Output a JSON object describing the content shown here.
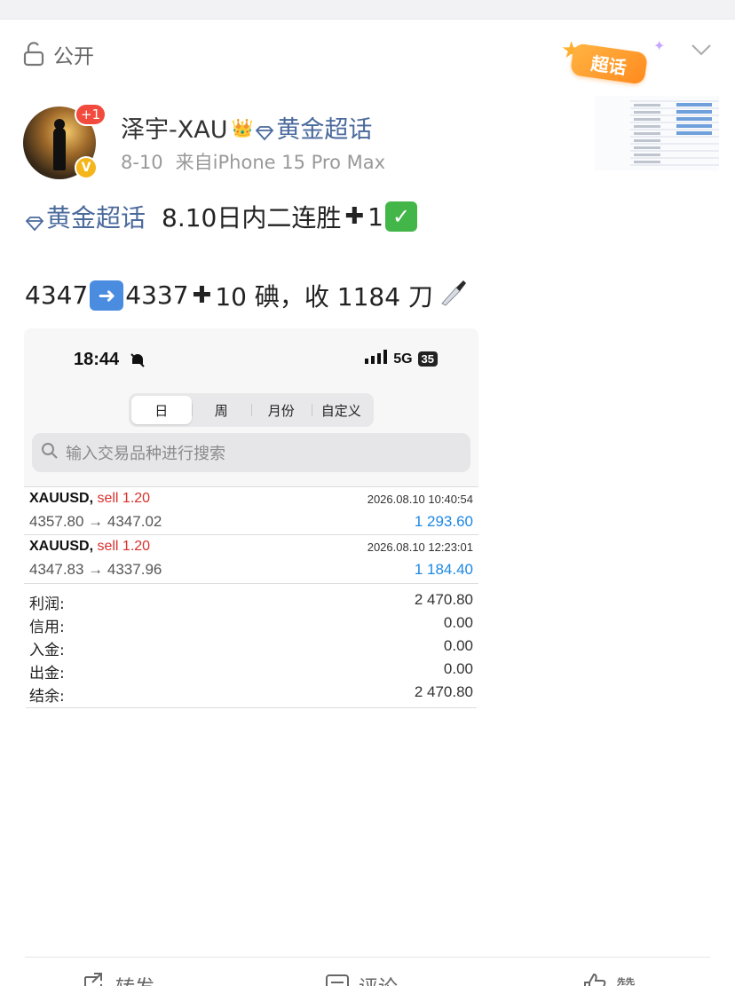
{
  "visibility": {
    "label": "公开"
  },
  "badge": {
    "label": "超话"
  },
  "author": {
    "name": "泽宇-XAU",
    "notify_count": "+1",
    "verified_mark": "V",
    "topic": "黄金超话",
    "date": "8-10",
    "source": "来自iPhone 15 Pro Max"
  },
  "post": {
    "line1_topic": "黄金超话",
    "line1_text": "8.10日内二连胜",
    "line1_count": "1",
    "line2_from": "4347",
    "line2_to": "4337",
    "line2_rest": "10 碘，收 1184 刀",
    "icons": [
      "diamond-icon",
      "plus-icon",
      "check-icon",
      "right-arrow-icon",
      "knife-icon"
    ]
  },
  "screenshot": {
    "time": "18:44",
    "network": "5G",
    "battery": "35",
    "tabs": [
      "日",
      "周",
      "月份",
      "自定义"
    ],
    "active_tab": "日",
    "search_placeholder": "输入交易品种进行搜索",
    "trades": [
      {
        "symbol": "XAUUSD,",
        "side": "sell 1.20",
        "datetime": "2026.08.10 10:40:54",
        "prices": "4357.80 → 4347.02",
        "profit": "1 293.60"
      },
      {
        "symbol": "XAUUSD,",
        "side": "sell 1.20",
        "datetime": "2026.08.10 12:23:01",
        "prices": "4347.83 → 4337.96",
        "profit": "1 184.40"
      }
    ],
    "summary": [
      {
        "label": "利润:",
        "value": "2 470.80"
      },
      {
        "label": "信用:",
        "value": "0.00"
      },
      {
        "label": "入金:",
        "value": "0.00"
      },
      {
        "label": "出金:",
        "value": "0.00"
      },
      {
        "label": "结余:",
        "value": "2 470.80"
      }
    ],
    "colors": {
      "sell": "#d9302c",
      "profit": "#1e88e5"
    }
  },
  "actions": {
    "repost": "转发",
    "comment": "评论",
    "like": "赞"
  }
}
